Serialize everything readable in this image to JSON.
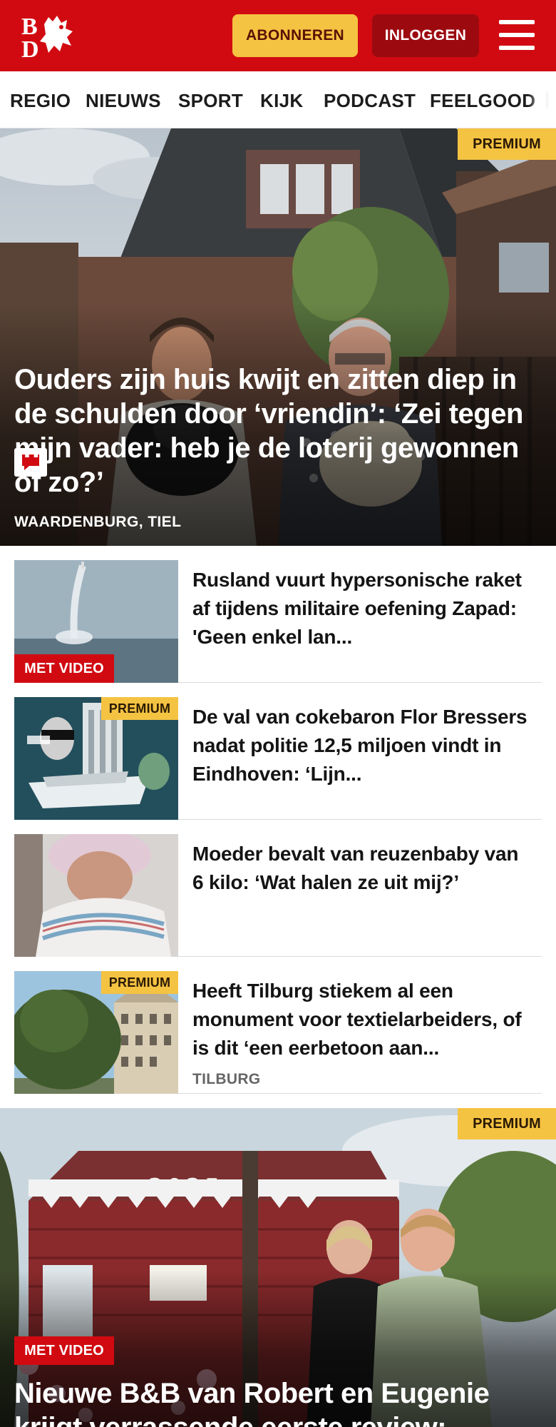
{
  "header": {
    "logo_text": "BD",
    "subscribe_label": "ABONNEREN",
    "login_label": "INLOGGEN",
    "brand_color": "#d10a11",
    "accent_color": "#f5c342"
  },
  "nav": {
    "items": [
      "REGIO",
      "NIEUWS",
      "SPORT",
      "KIJK",
      "PODCAST",
      "FEELGOOD"
    ]
  },
  "hero1": {
    "badge": "PREMIUM",
    "title": "Ouders zijn huis kwijt en zitten diep in de schulden door ‘vriendin’: ‘Zei tegen mijn vader: heb je de loterij gewonnen of zo?’",
    "location": "WAARDENBURG, TIEL",
    "icon": "comment-icon"
  },
  "articles": [
    {
      "badge": "MET VIDEO",
      "title": "Rusland vuurt hypersonische raket af tijdens militaire oefening Zapad: 'Geen enkel lan...",
      "location": ""
    },
    {
      "badge": "PREMIUM",
      "title": "De val van cokebaron Flor Bressers nadat politie 12,5 miljoen vindt in Eindhoven: ‘Lijn...",
      "location": ""
    },
    {
      "badge": "",
      "title": "Moeder bevalt van reuzenbaby van 6 kilo: ‘Wat halen ze uit mij?’",
      "location": ""
    },
    {
      "badge": "PREMIUM",
      "title": "Heeft Tilburg stiekem al een monument voor textielarbeiders, of is dit ‘een eerbetoon aan...",
      "location": "TILBURG"
    }
  ],
  "hero2": {
    "badge_premium": "PREMIUM",
    "badge_video": "MET VIDEO",
    "sign_text": "2025",
    "title": "Nieuwe B&B van Robert en Eugenie krijgt verrassende eerste review:"
  }
}
